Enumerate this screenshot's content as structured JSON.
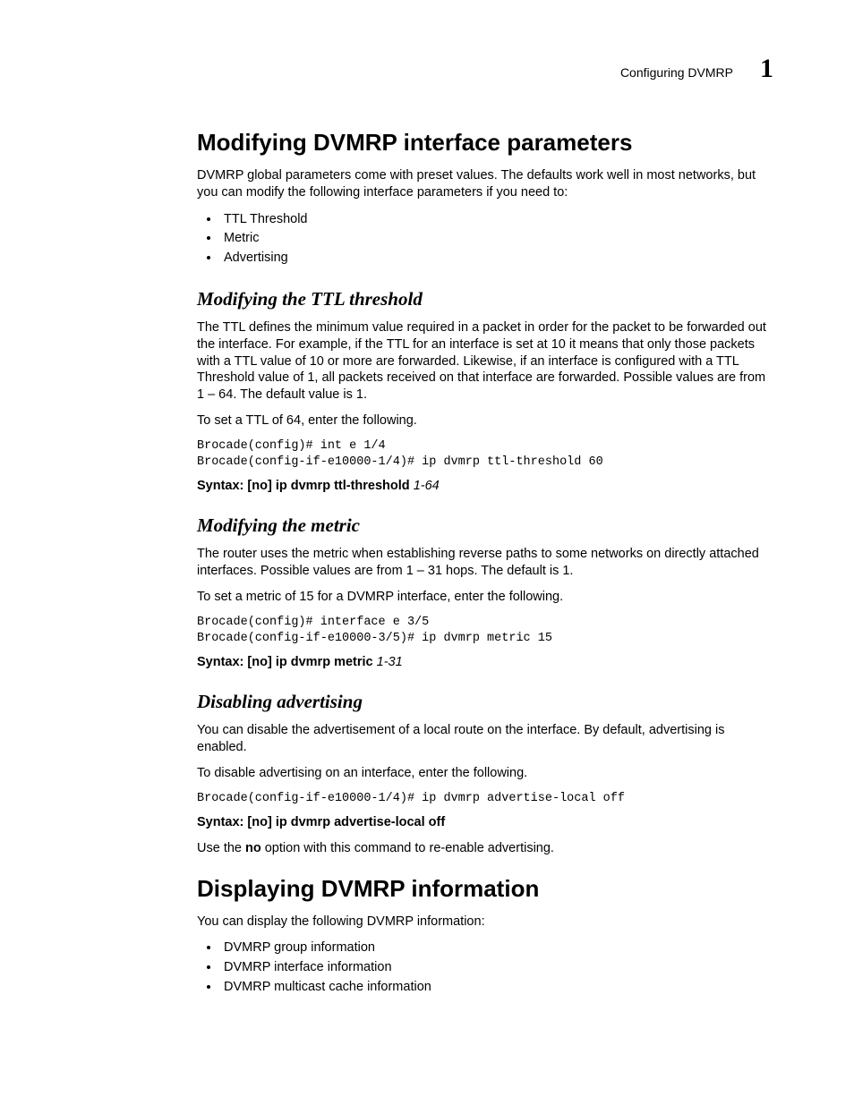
{
  "header": {
    "running_title": "Configuring DVMRP",
    "chapter_number": "1"
  },
  "sec1": {
    "title": "Modifying DVMRP interface parameters",
    "intro": "DVMRP global parameters come with preset values. The defaults work well in most networks, but you can modify the following interface parameters if you need to:",
    "bullets": [
      "TTL Threshold",
      "Metric",
      "Advertising"
    ]
  },
  "sub_ttl": {
    "title": "Modifying the TTL threshold",
    "para1": "The TTL defines the minimum value required in a packet in order for the packet to be forwarded out the interface. For example, if the TTL for an interface is set at 10 it means that only those packets with a TTL value of 10 or more are forwarded. Likewise, if an interface is configured with a TTL Threshold value of 1, all packets received on that interface are forwarded. Possible values are from 1 – 64. The default value is 1.",
    "lead": "To set a TTL of 64, enter the following.",
    "cli": "Brocade(config)# int e 1/4\nBrocade(config-if-e10000-1/4)# ip dvmrp ttl-threshold 60",
    "syntax_label": "Syntax:",
    "syntax_cmd": " [no] ip dvmrp ttl-threshold ",
    "syntax_arg": "1-64"
  },
  "sub_metric": {
    "title": "Modifying the metric",
    "para1": "The router uses the metric when establishing reverse paths to some networks on directly attached interfaces. Possible values are from 1 – 31 hops. The default is 1.",
    "lead": "To set a metric of 15 for a DVMRP interface, enter the following.",
    "cli": "Brocade(config)# interface e 3/5\nBrocade(config-if-e10000-3/5)# ip dvmrp metric 15",
    "syntax_label": "Syntax:",
    "syntax_cmd": " [no] ip dvmrp metric ",
    "syntax_arg": "1-31"
  },
  "sub_adv": {
    "title": "Disabling advertising",
    "para1": "You can disable the advertisement of a local route on the interface. By default, advertising is enabled.",
    "lead": "To disable advertising on an interface, enter the following.",
    "cli": "Brocade(config-if-e10000-1/4)# ip dvmrp advertise-local off",
    "syntax_label": "Syntax:",
    "syntax_cmd": " [no] ip dvmrp advertise-local off",
    "note_pre": "Use the ",
    "note_bold": "no",
    "note_post": " option with this command to re-enable advertising."
  },
  "sec2": {
    "title": "Displaying DVMRP information",
    "intro": "You can display the following DVMRP information:",
    "bullets": [
      "DVMRP group information",
      "DVMRP interface information",
      "DVMRP multicast cache information"
    ]
  }
}
